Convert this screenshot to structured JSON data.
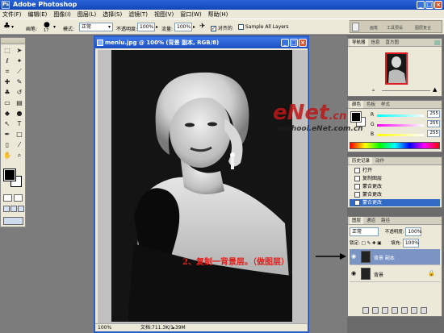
{
  "app": {
    "title": "Adobe Photoshop"
  },
  "menu": [
    "文件(F)",
    "编辑(E)",
    "图像(I)",
    "图层(L)",
    "选择(S)",
    "滤镜(T)",
    "视图(V)",
    "窗口(W)",
    "帮助(H)"
  ],
  "options": {
    "brush_label": "画笔:",
    "brush_size": "17",
    "mode_label": "模式:",
    "mode_value": "正常",
    "opacity_label": "不透明度:",
    "opacity_value": "100%",
    "flow_label": "流量:",
    "flow_value": "100%",
    "aligned_label": "对齐的",
    "sample_label": "Sample All Layers"
  },
  "palette_well": {
    "tabs": [
      "画笔",
      "工具预设",
      "图层复合"
    ]
  },
  "document": {
    "title": "menlu.jpg @ 100% (背景 副本, RGB/8)",
    "zoom": "100%",
    "doc_info": "文档:711.3K/1.39M"
  },
  "navigator": {
    "tabs": [
      "导航器",
      "信息",
      "直方图"
    ]
  },
  "color": {
    "tabs": [
      "颜色",
      "色板",
      "样式"
    ],
    "rows": [
      {
        "label": "R",
        "value": "255"
      },
      {
        "label": "G",
        "value": "255"
      },
      {
        "label": "B",
        "value": "255"
      }
    ]
  },
  "history": {
    "tabs": [
      "历史记录",
      "动作"
    ],
    "items": [
      "打开",
      "复制图层",
      "蒙合更改",
      "蒙合更改",
      "蒙合更改"
    ]
  },
  "layers": {
    "tabs": [
      "图层",
      "通道",
      "路径"
    ],
    "mode_value": "正常",
    "opacity_label": "不透明度:",
    "opacity_value": "100%",
    "lock_label": "锁定:",
    "fill_label": "填充:",
    "fill_value": "100%",
    "rows": [
      {
        "name": "背景 副本"
      },
      {
        "name": "背景"
      }
    ]
  },
  "annotation": {
    "text": "2、复制一背景层。（做图层）"
  },
  "watermark": {
    "main": "eNet",
    "suffix": ".cn",
    "sub": "eschool.eNet.com.cn"
  }
}
